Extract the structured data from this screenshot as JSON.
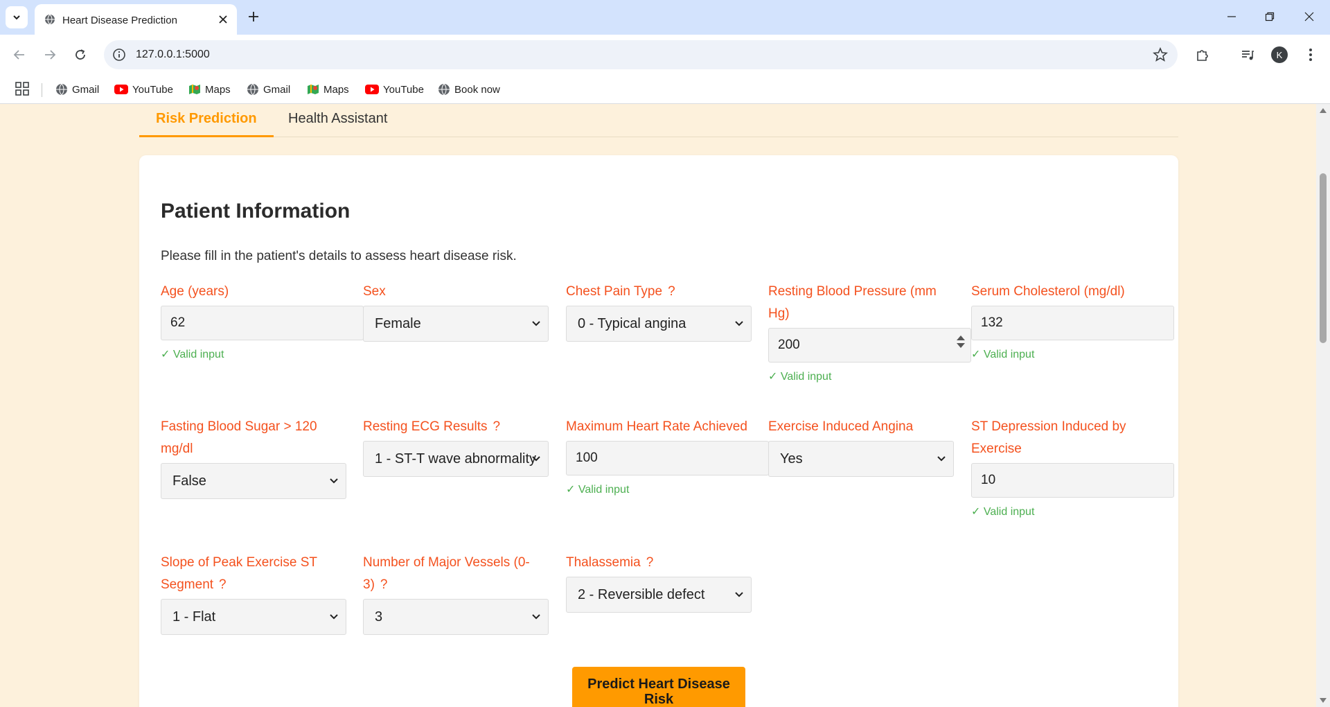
{
  "browser": {
    "tab_title": "Heart Disease Prediction",
    "url": "127.0.0.1:5000",
    "avatar_letter": "K",
    "bookmarks": [
      {
        "label": "Gmail",
        "icon": "globe-icon"
      },
      {
        "label": "YouTube",
        "icon": "youtube-icon"
      },
      {
        "label": "Maps",
        "icon": "maps-icon"
      },
      {
        "label": "Gmail",
        "icon": "globe-icon"
      },
      {
        "label": "Maps",
        "icon": "maps-icon"
      },
      {
        "label": "YouTube",
        "icon": "youtube-icon"
      },
      {
        "label": "Book now",
        "icon": "globe-icon"
      }
    ]
  },
  "page_tabs": {
    "risk": "Risk Prediction",
    "assistant": "Health Assistant"
  },
  "form": {
    "title": "Patient Information",
    "description": "Please fill in the patient's details to assess heart disease risk.",
    "valid_text": "✓ Valid input",
    "help_mark": "?",
    "fields": {
      "age": {
        "label": "Age (years)",
        "value": "62"
      },
      "sex": {
        "label": "Sex",
        "value": "Female"
      },
      "chest_pain": {
        "label": "Chest Pain Type",
        "value": "0 - Typical angina"
      },
      "resting_bp": {
        "label": "Resting Blood Pressure (mm Hg)",
        "value": "200"
      },
      "cholesterol": {
        "label": "Serum Cholesterol (mg/dl)",
        "value": "132"
      },
      "fbs": {
        "label": "Fasting Blood Sugar > 120 mg/dl",
        "value": "False"
      },
      "ecg": {
        "label": "Resting ECG Results",
        "value": "1 - ST-T wave abnormality"
      },
      "max_hr": {
        "label": "Maximum Heart Rate Achieved",
        "value": "100"
      },
      "angina": {
        "label": "Exercise Induced Angina",
        "value": "Yes"
      },
      "st_depression": {
        "label": "ST Depression Induced by Exercise",
        "value": "10"
      },
      "slope": {
        "label": "Slope of Peak Exercise ST Segment",
        "value": "1 - Flat"
      },
      "vessels": {
        "label": "Number of Major Vessels (0-3)",
        "value": "3"
      },
      "thal": {
        "label": "Thalassemia",
        "value": "2 - Reversible defect"
      }
    },
    "submit_label": "Predict Heart Disease Risk"
  },
  "colors": {
    "accent": "#ff9900",
    "label": "#f4511e",
    "valid": "#4caf50",
    "page_bg": "#fdf1dc"
  }
}
